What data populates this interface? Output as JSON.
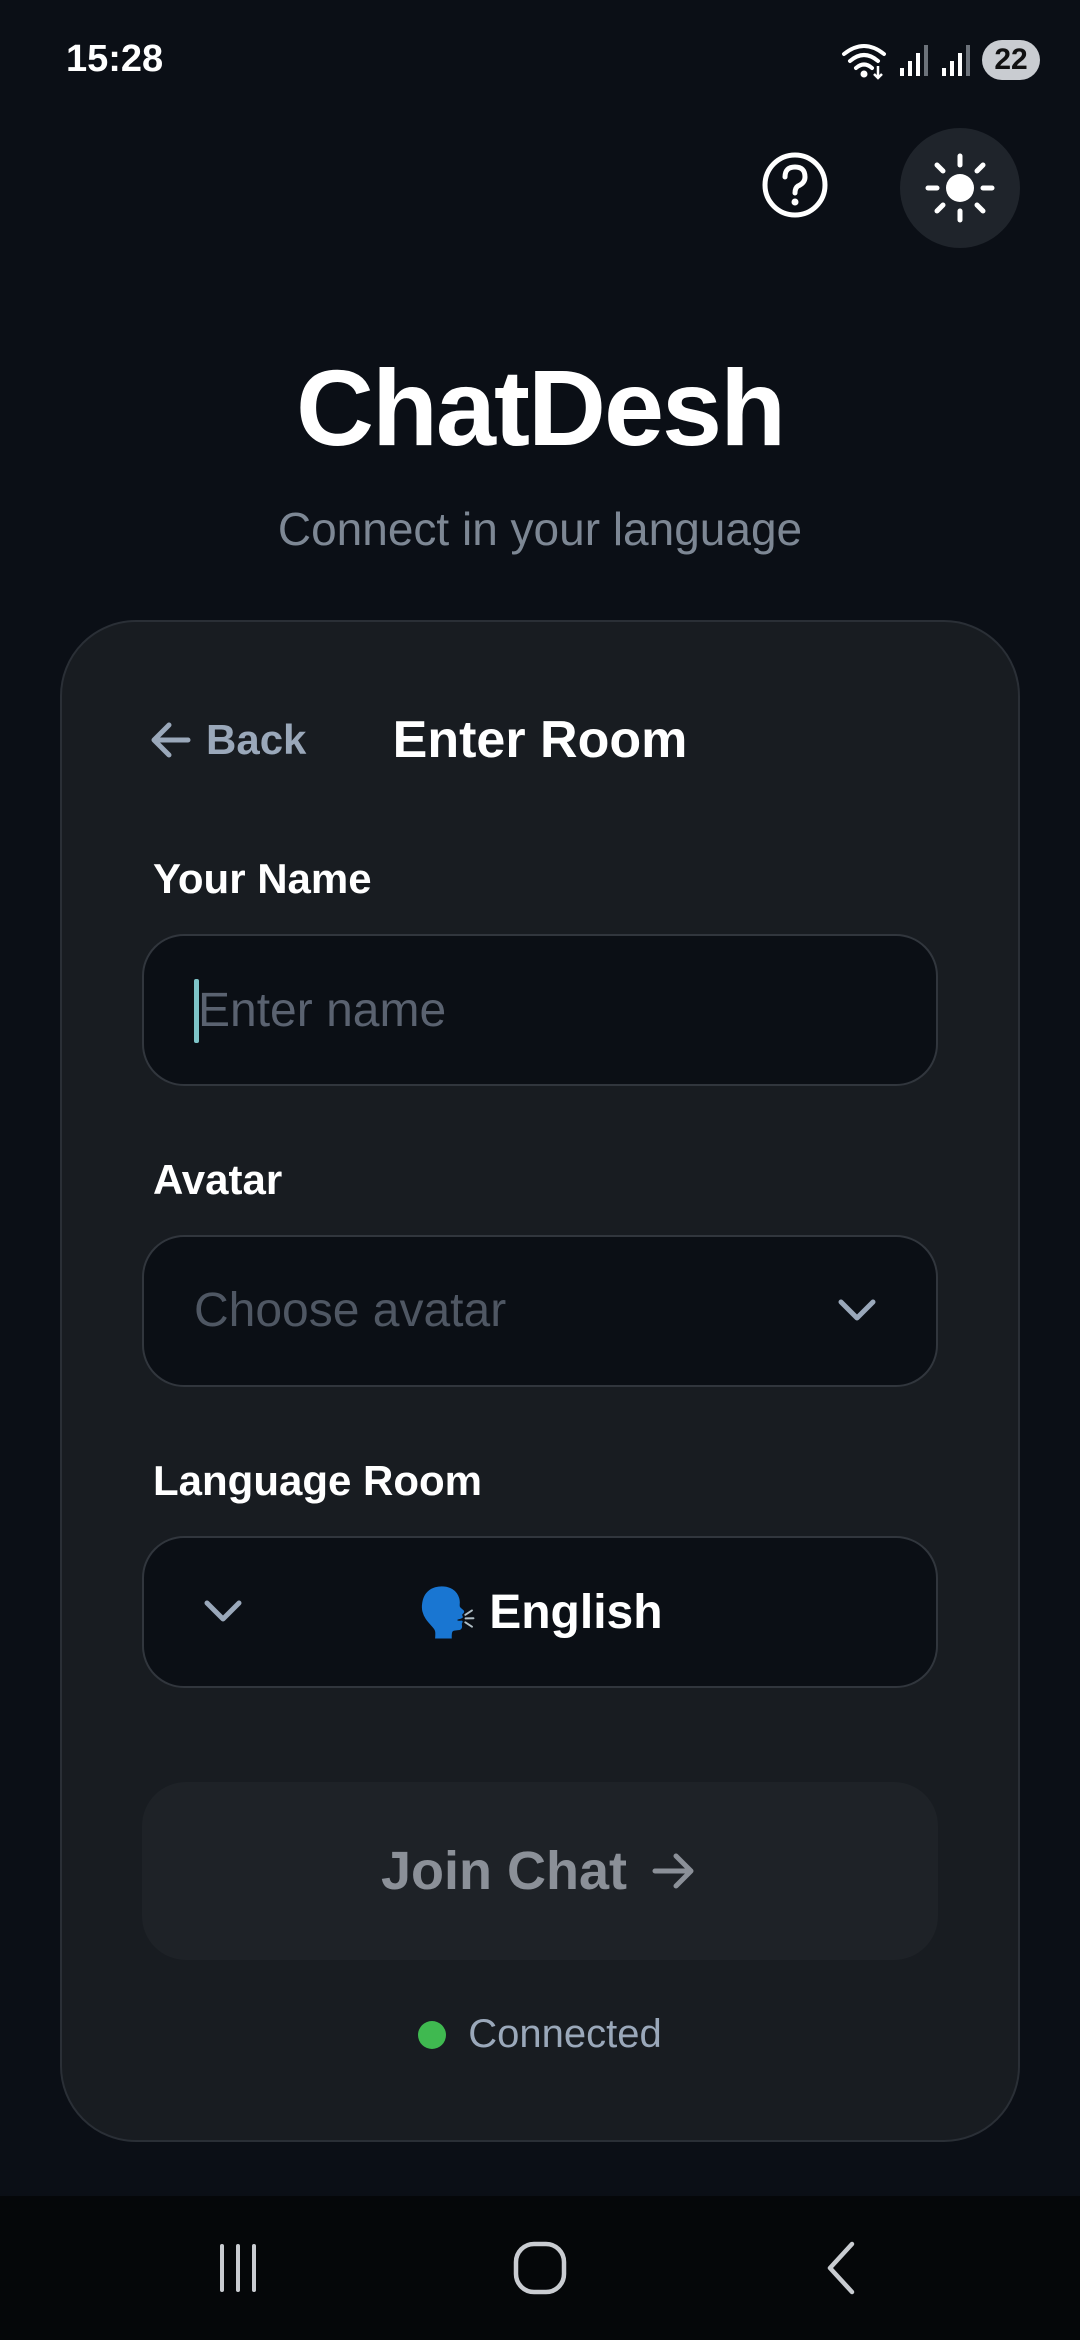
{
  "status_bar": {
    "time": "15:28",
    "battery": "22",
    "icons": [
      "wifi-icon",
      "signal-icon",
      "signal-icon"
    ]
  },
  "header": {
    "help_icon": "help-circle-icon",
    "theme_icon": "sun-icon"
  },
  "app": {
    "title": "ChatDesh",
    "subtitle": "Connect in your language"
  },
  "card": {
    "back_label": "Back",
    "title": "Enter Room",
    "name": {
      "label": "Your Name",
      "placeholder": "Enter name",
      "value": ""
    },
    "avatar": {
      "label": "Avatar",
      "placeholder": "Choose avatar"
    },
    "language": {
      "label": "Language Room",
      "emoji": "🗣️",
      "value": "English"
    },
    "join_label": "Join Chat",
    "connection_status": "Connected"
  },
  "colors": {
    "background": "#0b0f16",
    "card": "#181c21",
    "accent_caret": "#7ec4c8",
    "connected": "#3fb950"
  },
  "nav_bar": {
    "icons": [
      "recent-apps-icon",
      "home-icon",
      "back-icon"
    ]
  }
}
